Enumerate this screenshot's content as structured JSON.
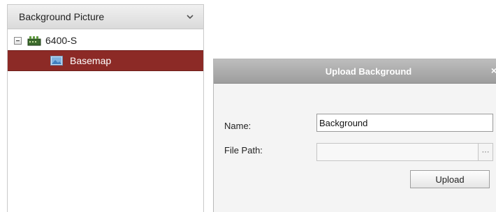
{
  "left_panel": {
    "title": "Background Picture",
    "tree": {
      "device_label": "6400-S",
      "child_label": "Basemap"
    }
  },
  "dialog": {
    "title": "Upload Background",
    "close_glyph": "×",
    "name_label": "Name:",
    "name_value": "Background",
    "file_path_label": "File Path:",
    "file_path_value": "",
    "browse_glyph": "···",
    "upload_label": "Upload"
  },
  "colors": {
    "selected_row": "#8c2a26",
    "dialog_titlebar": "#adadad"
  },
  "icons": [
    "chevron-down-icon",
    "collapse-icon",
    "device-icon",
    "map-icon",
    "close-icon",
    "ellipsis-icon"
  ]
}
